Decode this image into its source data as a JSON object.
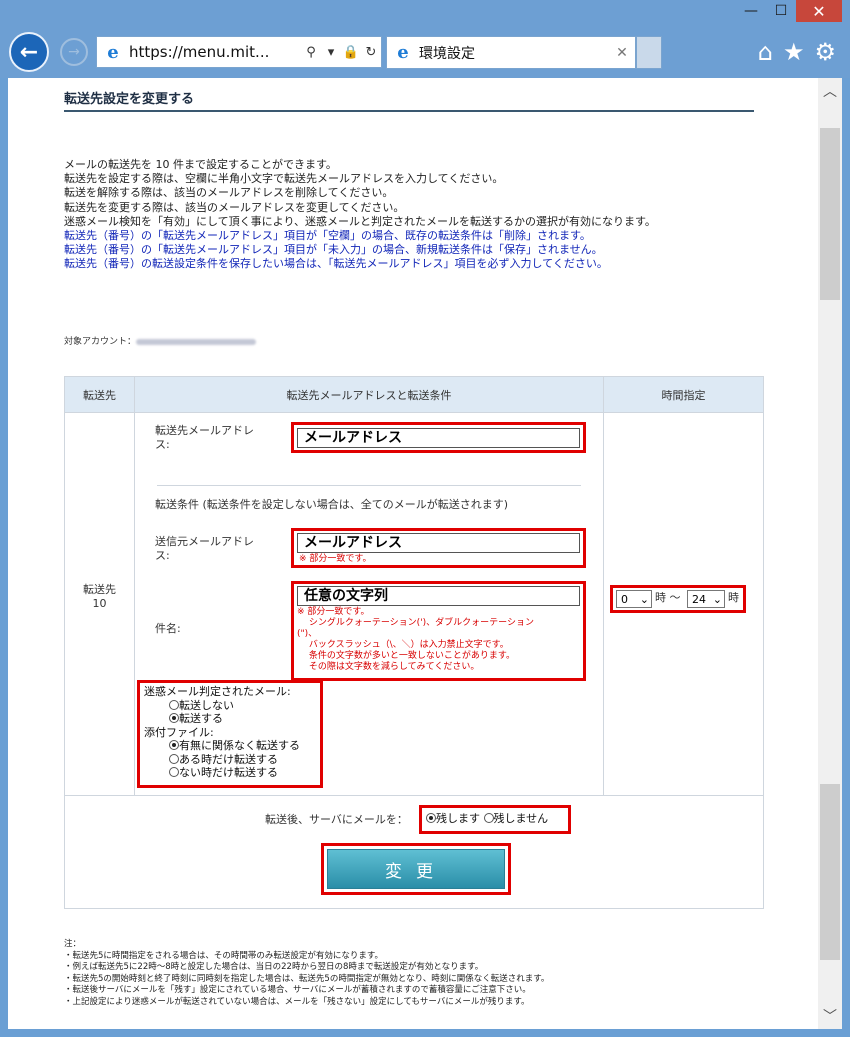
{
  "browser": {
    "url": "https://menu.mit...",
    "tab_title": "環境設定",
    "window_controls": {
      "minimize": "—",
      "maximize": "☐",
      "close": "✕"
    }
  },
  "page": {
    "heading": "転送先設定を変更する",
    "intro_lines": [
      "メールの転送先を 10 件まで設定することができます。",
      "転送先を設定する際は、空欄に半角小文字で転送先メールアドレスを入力してください。",
      "転送を解除する際は、該当のメールアドレスを削除してください。",
      "転送先を変更する際は、該当のメールアドレスを変更してください。",
      "迷惑メール検知を「有効」にして頂く事により、迷惑メールと判定されたメールを転送するかの選択が有効になります。"
    ],
    "intro_blue_lines": [
      "転送先（番号）の「転送先メールアドレス」項目が「空欄」の場合、既存の転送条件は「削除」されます。",
      "転送先（番号）の「転送先メールアドレス」項目が「未入力」の場合、新規転送条件は「保存」されません。",
      "転送先（番号）の転送設定条件を保存したい場合は、「転送先メールアドレス」項目を必ず入力してください。"
    ],
    "account_label": "対象アカウント：",
    "table": {
      "col_dest": "転送先",
      "col_address": "転送先メールアドレスと転送条件",
      "col_time": "時間指定",
      "dest_label": "転送先",
      "dest_number": "10",
      "address_label_1": "転送先メールアドレ",
      "address_label_2": "ス:",
      "address_value": "メールアドレス",
      "condition_heading": "転送条件 (転送条件を設定しない場合は、全てのメールが転送されます)",
      "sender_label_1": "送信元メールアドレ",
      "sender_label_2": "ス:",
      "sender_value": "メールアドレス",
      "sender_note": "※ 部分一致です。",
      "subject_label": "件名:",
      "subject_value": "任意の文字列",
      "subject_notes": [
        "※ 部分一致です。",
        "　 シングルクォーテーション(')、ダブルクォーテーション",
        "(\")、",
        "　 バックスラッシュ（\\、＼）は入力禁止文字です。",
        "　 条件の文字数が多いと一致しないことがあります。",
        "　 その際は文字数を減らしてみてください。"
      ],
      "spam_label": "迷惑メール判定されたメール:",
      "spam_options": [
        "転送しない",
        "転送する"
      ],
      "spam_selected": 1,
      "attach_label": "添付ファイル:",
      "attach_options": [
        "有無に関係なく転送する",
        "ある時だけ転送する",
        "ない時だけ転送する"
      ],
      "attach_selected": 0,
      "time_from": "0",
      "time_from_unit": "時 〜",
      "time_to": "24",
      "time_to_unit": "時",
      "keep_label": "転送後、サーバにメールを：",
      "keep_options": [
        "残します",
        "残しません"
      ],
      "keep_selected": 0,
      "submit_label": "変更"
    },
    "notes_heading": "注：",
    "notes": [
      "・転送先5に時間指定をされる場合は、その時間帯のみ転送設定が有効になります。",
      "・例えば転送先5に22時〜8時と設定した場合は、当日の22時から翌日の8時まで転送設定が有効となります。",
      "・転送先5の開始時刻と終了時刻に同時刻を指定した場合は、転送先5の時間指定が無効となり、時刻に関係なく転送されます。",
      "・転送後サーバにメールを「残す」設定にされている場合、サーバにメールが蓄積されますので蓄積容量にご注意下さい。",
      "・上記設定により迷惑メールが転送されていない場合は、メールを「残さない」設定にしてもサーバにメールが残ります。"
    ]
  }
}
